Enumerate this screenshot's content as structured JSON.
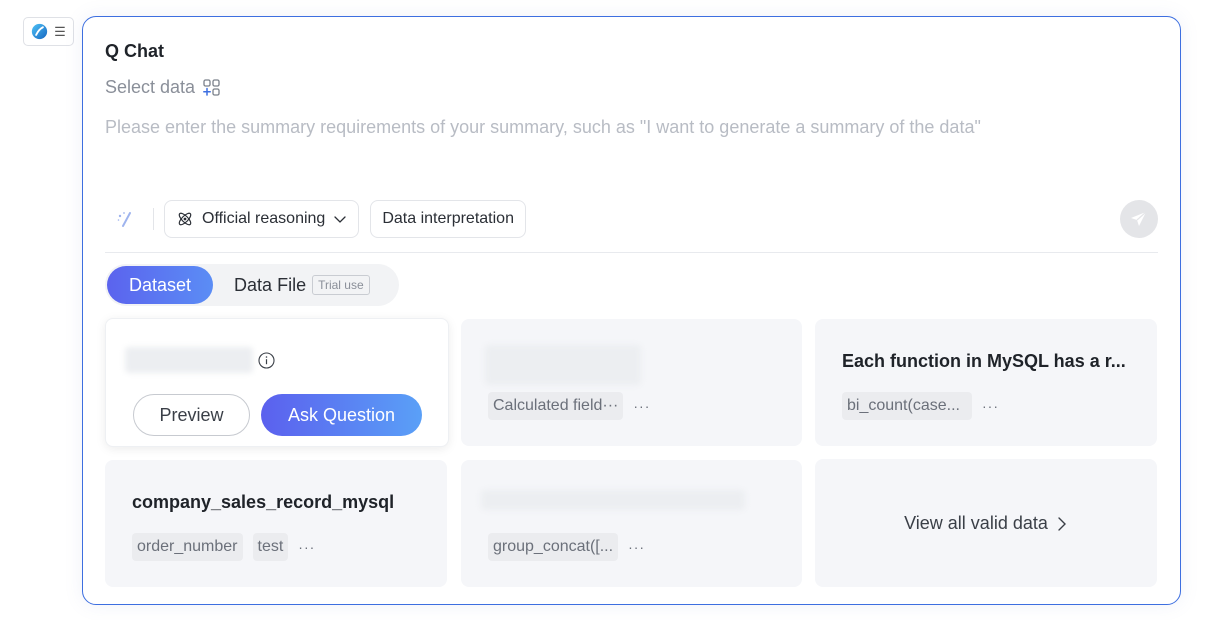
{
  "app": {
    "menu_glyph": "☰"
  },
  "header": {
    "title": "Q Chat",
    "select_data_label": "Select data",
    "prompt_placeholder": "Please enter the summary requirements of your summary, such as \"I want to generate a summary of the data\""
  },
  "toolbar": {
    "reasoning_label": "Official reasoning",
    "interpretation_label": "Data interpretation"
  },
  "tabs": {
    "dataset_label": "Dataset",
    "datafile_label": "Data File",
    "trial_badge": "Trial use"
  },
  "cards": {
    "card1": {
      "preview_label": "Preview",
      "ask_label": "Ask Question"
    },
    "card2": {
      "tags": [
        "Calculated field···"
      ],
      "more": "···"
    },
    "card3": {
      "title": "Each function in MySQL has a r...",
      "tags": [
        "bi_count(case..."
      ],
      "more": "···"
    },
    "card4": {
      "title": "company_sales_record_mysql",
      "tags": [
        "order_number",
        "test"
      ],
      "more": "···"
    },
    "card5": {
      "tags": [
        "group_concat([..."
      ],
      "more": "···"
    },
    "card6": {
      "view_all_label": "View all valid data"
    }
  },
  "colors": {
    "accent": "#5b63ee",
    "border": "#3d6fe0"
  }
}
